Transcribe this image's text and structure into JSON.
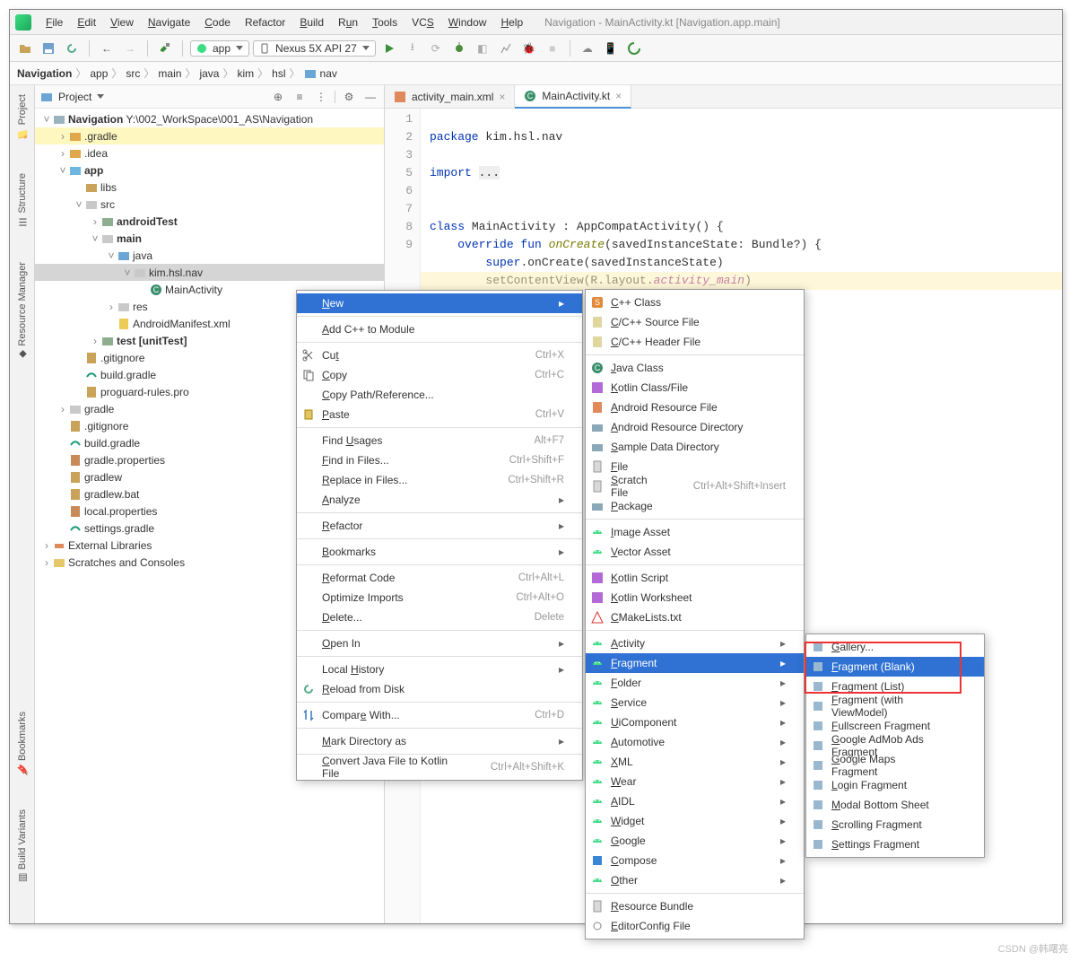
{
  "window_title": "Navigation - MainActivity.kt [Navigation.app.main]",
  "menubar": [
    "File",
    "Edit",
    "View",
    "Navigate",
    "Code",
    "Refactor",
    "Build",
    "Run",
    "Tools",
    "VCS",
    "Window",
    "Help"
  ],
  "toolbar": {
    "module": "app",
    "device": "Nexus 5X API 27"
  },
  "breadcrumbs": [
    "Navigation",
    "app",
    "src",
    "main",
    "java",
    "kim",
    "hsl",
    "nav"
  ],
  "panel": {
    "mode": "Project"
  },
  "tree": {
    "root": {
      "name": "Navigation",
      "path": "Y:\\002_WorkSpace\\001_AS\\Navigation"
    },
    "gradle_mod": ".gradle",
    "idea": ".idea",
    "app": "app",
    "libs": "libs",
    "src": "src",
    "androidTest": "androidTest",
    "main": "main",
    "java": "java",
    "pkg": "kim.hsl.nav",
    "mainActivity": "MainActivity",
    "res": "res",
    "manifest": "AndroidManifest.xml",
    "test": "test",
    "unitTest": "[unitTest]",
    "gitignore1": ".gitignore",
    "buildgradle1": "build.gradle",
    "proguard": "proguard-rules.pro",
    "gradle_folder": "gradle",
    "gitignore2": ".gitignore",
    "buildgradle2": "build.gradle",
    "gradleprops": "gradle.properties",
    "gradlew": "gradlew",
    "gradlewbat": "gradlew.bat",
    "localprops": "local.properties",
    "settingsgradle": "settings.gradle",
    "extlibs": "External Libraries",
    "scratches": "Scratches and Consoles"
  },
  "tabs": {
    "t1": "activity_main.xml",
    "t2": "MainActivity.kt"
  },
  "code": {
    "l1": "package kim.hsl.nav",
    "l2": "",
    "l3": "import ...",
    "l4": "",
    "l5": "",
    "l6": "class MainActivity : AppCompatActivity() {",
    "l7": "    override fun onCreate(savedInstanceState: Bundle?) {",
    "l8": "        super.onCreate(savedInstanceState)",
    "l9": "        setContentView(R.layout.activity_main)"
  },
  "gutter": [
    "1",
    "2",
    "3",
    "",
    "5",
    "6",
    "7",
    "8",
    "9"
  ],
  "ctx1": [
    {
      "label": "New",
      "sel": true,
      "arrow": true,
      "k": "new"
    },
    "---",
    {
      "label": "Add C++ to Module",
      "k": "addcpp"
    },
    "---",
    {
      "label": "Cut",
      "shortcut": "Ctrl+X",
      "icon": "cut",
      "k": "cut"
    },
    {
      "label": "Copy",
      "shortcut": "Ctrl+C",
      "icon": "copy",
      "k": "copy"
    },
    {
      "label": "Copy Path/Reference...",
      "k": "copypath"
    },
    {
      "label": "Paste",
      "shortcut": "Ctrl+V",
      "icon": "paste",
      "k": "paste"
    },
    "---",
    {
      "label": "Find Usages",
      "shortcut": "Alt+F7",
      "k": "findusages"
    },
    {
      "label": "Find in Files...",
      "shortcut": "Ctrl+Shift+F",
      "k": "findfiles"
    },
    {
      "label": "Replace in Files...",
      "shortcut": "Ctrl+Shift+R",
      "k": "replacefiles"
    },
    {
      "label": "Analyze",
      "arrow": true,
      "k": "analyze"
    },
    "---",
    {
      "label": "Refactor",
      "arrow": true,
      "k": "refactor"
    },
    "---",
    {
      "label": "Bookmarks",
      "arrow": true,
      "k": "bookmarks"
    },
    "---",
    {
      "label": "Reformat Code",
      "shortcut": "Ctrl+Alt+L",
      "k": "reformat"
    },
    {
      "label": "Optimize Imports",
      "shortcut": "Ctrl+Alt+O",
      "k": "optimize"
    },
    {
      "label": "Delete...",
      "shortcut": "Delete",
      "k": "delete"
    },
    "---",
    {
      "label": "Open In",
      "arrow": true,
      "k": "openin"
    },
    "---",
    {
      "label": "Local History",
      "arrow": true,
      "k": "localhist"
    },
    {
      "label": "Reload from Disk",
      "icon": "reload",
      "k": "reload"
    },
    "---",
    {
      "label": "Compare With...",
      "shortcut": "Ctrl+D",
      "icon": "compare",
      "k": "compare"
    },
    "---",
    {
      "label": "Mark Directory as",
      "arrow": true,
      "k": "markdir"
    },
    "---",
    {
      "label": "Convert Java File to Kotlin File",
      "shortcut": "Ctrl+Alt+Shift+K",
      "k": "convert"
    }
  ],
  "ctx2": [
    {
      "label": "C++ Class",
      "icon": "S"
    },
    {
      "label": "C/C++ Source File",
      "icon": "cpp"
    },
    {
      "label": "C/C++ Header File",
      "icon": "h"
    },
    "---",
    {
      "label": "Java Class",
      "icon": "C"
    },
    {
      "label": "Kotlin Class/File",
      "icon": "kt"
    },
    {
      "label": "Android Resource File",
      "icon": "xmlg"
    },
    {
      "label": "Android Resource Directory",
      "icon": "folder"
    },
    {
      "label": "Sample Data Directory",
      "icon": "folder"
    },
    {
      "label": "File",
      "icon": "file"
    },
    {
      "label": "Scratch File",
      "shortcut": "Ctrl+Alt+Shift+Insert",
      "icon": "file"
    },
    {
      "label": "Package",
      "icon": "folder"
    },
    "---",
    {
      "label": "Image Asset",
      "icon": "android"
    },
    {
      "label": "Vector Asset",
      "icon": "android"
    },
    "---",
    {
      "label": "Kotlin Script",
      "icon": "kt"
    },
    {
      "label": "Kotlin Worksheet",
      "icon": "kt"
    },
    {
      "label": "CMakeLists.txt",
      "icon": "cmake"
    },
    "---",
    {
      "label": "Activity",
      "arrow": true,
      "icon": "android"
    },
    {
      "label": "Fragment",
      "arrow": true,
      "icon": "android",
      "sel": true
    },
    {
      "label": "Folder",
      "arrow": true,
      "icon": "android"
    },
    {
      "label": "Service",
      "arrow": true,
      "icon": "android"
    },
    {
      "label": "UiComponent",
      "arrow": true,
      "icon": "android"
    },
    {
      "label": "Automotive",
      "arrow": true,
      "icon": "android"
    },
    {
      "label": "XML",
      "arrow": true,
      "icon": "android"
    },
    {
      "label": "Wear",
      "arrow": true,
      "icon": "android"
    },
    {
      "label": "AIDL",
      "arrow": true,
      "icon": "android"
    },
    {
      "label": "Widget",
      "arrow": true,
      "icon": "android"
    },
    {
      "label": "Google",
      "arrow": true,
      "icon": "android"
    },
    {
      "label": "Compose",
      "arrow": true,
      "icon": "compose"
    },
    {
      "label": "Other",
      "arrow": true,
      "icon": "android"
    },
    "---",
    {
      "label": "Resource Bundle",
      "icon": "file"
    },
    {
      "label": "EditorConfig File",
      "icon": "cfg"
    }
  ],
  "ctx3": [
    {
      "label": "Gallery..."
    },
    {
      "label": "Fragment (Blank)",
      "sel": true
    },
    {
      "label": "Fragment (List)"
    },
    {
      "label": "Fragment (with ViewModel)"
    },
    {
      "label": "Fullscreen Fragment"
    },
    {
      "label": "Google AdMob Ads Fragment"
    },
    {
      "label": "Google Maps Fragment"
    },
    {
      "label": "Login Fragment"
    },
    {
      "label": "Modal Bottom Sheet"
    },
    {
      "label": "Scrolling Fragment"
    },
    {
      "label": "Settings Fragment"
    }
  ],
  "side_tabs": {
    "project": "Project",
    "resmgr": "Resource Manager",
    "structure": "Structure",
    "bookmarks": "Bookmarks",
    "buildvar": "Build Variants"
  },
  "watermark": "CSDN @韩曙亮"
}
